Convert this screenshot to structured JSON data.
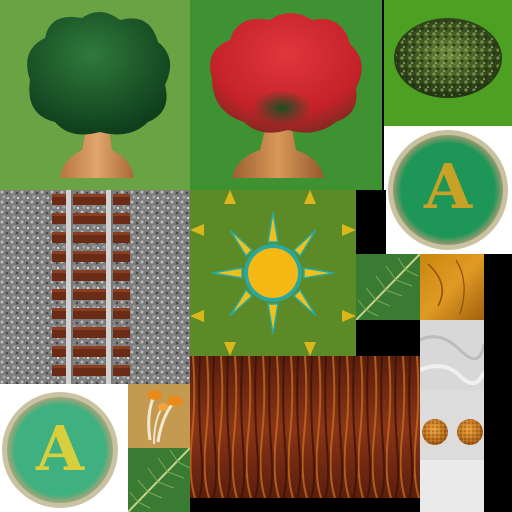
{
  "atlas": {
    "badge_large": {
      "letter": "A",
      "ring_color": "#1d9658",
      "letter_color": "#c7a227"
    },
    "badge_small": {
      "letter": "A",
      "ring_color": "#3fb07f",
      "letter_color": "#d8cf3f"
    },
    "tiles": [
      {
        "name": "green-tree",
        "icon": "tree-icon",
        "color": "#1f5a2a"
      },
      {
        "name": "red-tree",
        "icon": "tree-icon",
        "color": "#c8242b"
      },
      {
        "name": "bush",
        "icon": "bush-icon",
        "color": "#3f5a22"
      },
      {
        "name": "railroad-track",
        "icon": "rail-icon",
        "color": "#7b7b7b"
      },
      {
        "name": "sun-grass",
        "icon": "sun-icon",
        "color": "#f4b51a"
      },
      {
        "name": "leaf",
        "icon": "leaf-icon",
        "color": "#3a7b34"
      },
      {
        "name": "wood-plank",
        "icon": "wood-icon",
        "color": "#b5730f"
      },
      {
        "name": "marble",
        "icon": "marble-icon",
        "color": "#d4d4d4"
      },
      {
        "name": "cookies",
        "icon": "cookie-icon",
        "color": "#c7771f"
      },
      {
        "name": "brown-bark",
        "icon": "bark-icon",
        "color": "#7a2a12"
      },
      {
        "name": "mushroom-sprouts",
        "icon": "sprout-icon",
        "color": "#e98a1a"
      }
    ]
  }
}
